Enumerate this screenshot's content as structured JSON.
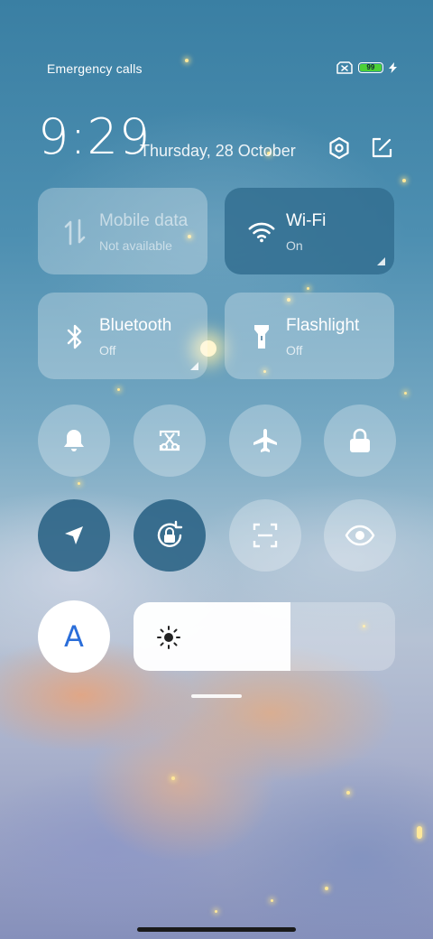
{
  "status_bar": {
    "left_text": "Emergency calls",
    "battery_level": "99",
    "battery_fraction": 0.99,
    "charging": true,
    "icons": [
      "no-sim-icon",
      "battery-icon",
      "charging-bolt-icon"
    ]
  },
  "header": {
    "time": "9:29",
    "date": "Thursday, 28 October",
    "icons": [
      "settings-icon",
      "edit-icon"
    ]
  },
  "tiles": {
    "mobile_data": {
      "title": "Mobile data",
      "subtitle": "Not available",
      "icon": "mobile-data-icon",
      "state": "disabled"
    },
    "wifi": {
      "title": "Wi-Fi",
      "subtitle": "On",
      "icon": "wifi-icon",
      "state": "on"
    },
    "bluetooth": {
      "title": "Bluetooth",
      "subtitle": "Off",
      "icon": "bluetooth-icon",
      "state": "off"
    },
    "flashlight": {
      "title": "Flashlight",
      "subtitle": "Off",
      "icon": "flashlight-icon",
      "state": "off"
    }
  },
  "toggles_row1": [
    {
      "icon": "bell-icon",
      "state": "off"
    },
    {
      "icon": "screenshot-scissors-icon",
      "state": "off"
    },
    {
      "icon": "airplane-icon",
      "state": "off"
    },
    {
      "icon": "lock-icon",
      "state": "off"
    }
  ],
  "toggles_row2": [
    {
      "icon": "location-icon",
      "state": "on"
    },
    {
      "icon": "rotation-lock-icon",
      "state": "on"
    },
    {
      "icon": "scanner-icon",
      "state": "off"
    },
    {
      "icon": "eye-icon",
      "state": "off"
    }
  ],
  "brightness": {
    "auto_label": "A",
    "level": 0.6,
    "icon": "sun-icon"
  },
  "colors": {
    "active_toggle": "#2c6486",
    "battery_green": "#4cd137",
    "auto_text": "#2b6ed9"
  }
}
